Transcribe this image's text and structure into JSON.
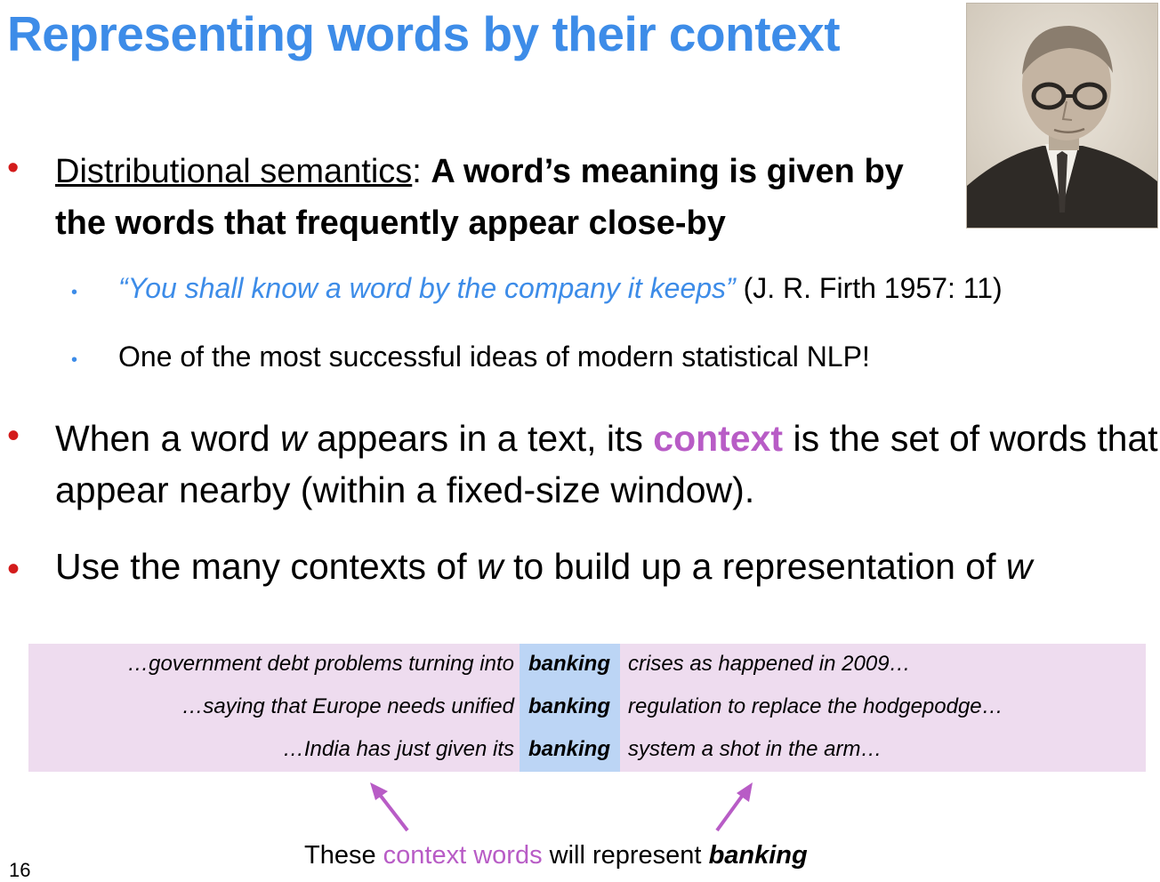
{
  "slide": {
    "title": "Representing words by their context",
    "page_number": "16"
  },
  "bullets": {
    "b1_underline": "Distributional semantics",
    "b1_colon": ": ",
    "b1_bold": "A word’s meaning is given by the words that frequently appear close-by",
    "sub1_quote": "“You shall know a word by the company it keeps”",
    "sub1_cite": " (J. R. Firth 1957: 11)",
    "sub2": "One of the most successful ideas of modern statistical NLP!",
    "b2_pre": "When a word ",
    "b2_w": "w",
    "b2_mid": " appears in a text, its ",
    "b2_ctx": "context",
    "b2_post": " is the set of words that appear nearby (within a fixed-size window).",
    "b3_pre": "Use the many contexts of ",
    "b3_w1": "w",
    "b3_mid": " to build up a representation of ",
    "b3_w2": "w"
  },
  "concordance": {
    "rows": [
      {
        "left": "…government debt problems turning into",
        "center": "banking",
        "right": "crises as happened in 2009…"
      },
      {
        "left": "…saying that Europe needs unified",
        "center": "banking",
        "right": "regulation to replace the hodgepodge…"
      },
      {
        "left": "…India has just given its",
        "center": "banking",
        "right": "system a shot in the arm…"
      }
    ]
  },
  "footer": {
    "pre": "These ",
    "context_words": "context words",
    "mid": " will represent ",
    "banking": "banking"
  },
  "colors": {
    "title": "#3d8ce8",
    "bullet": "#d31b1b",
    "context_highlight": "#b85cc6",
    "panel_bg": "#eedcef",
    "center_bg": "#bcd5f5"
  }
}
